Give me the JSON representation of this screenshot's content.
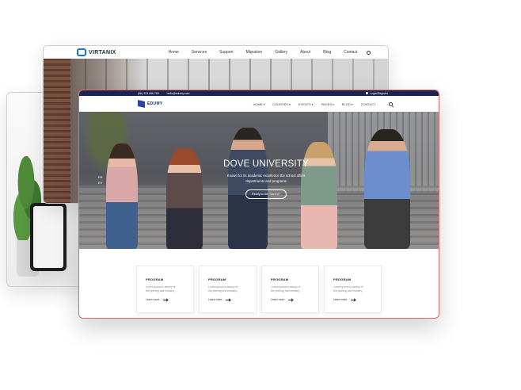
{
  "back_site": {
    "logo": "VIRTANIX",
    "nav": [
      "Home",
      "Services",
      "Support",
      "Migration",
      "Gallery",
      "About",
      "Blog",
      "Contact"
    ]
  },
  "main_site": {
    "topbar": {
      "phone": "(56) 123 456 789",
      "email": "hello@edumy.com",
      "login": "Login/Register"
    },
    "logo": "EDUMY",
    "nav": [
      "HOME",
      "COURSES",
      "EVENTS",
      "PAGES",
      "BLOG",
      "CONTACT"
    ],
    "hero": {
      "side_lines": [
        "PR",
        "EV"
      ],
      "title": "DOVE UNIVERSITY",
      "subtitle_line1": "Known for its academic excellence the school offers",
      "subtitle_line2": "departments and programs",
      "button": "Ready to Get Started?"
    },
    "cards": [
      {
        "title": "PROGRAM",
        "text1": "Lorem ipsum is simply of",
        "text2": "the printing and industry.",
        "link": "Learn more"
      },
      {
        "title": "PROGRAM",
        "text1": "Lorem ipsum is simply of",
        "text2": "the printing and industry.",
        "link": "Learn more"
      },
      {
        "title": "PROGRAM",
        "text1": "Lorem ipsum is simply of",
        "text2": "the printing and industry.",
        "link": "Learn more"
      },
      {
        "title": "PROGRAM",
        "text1": "Lorem ipsum is simply of",
        "text2": "the printing and industry.",
        "link": "Learn more"
      }
    ]
  }
}
